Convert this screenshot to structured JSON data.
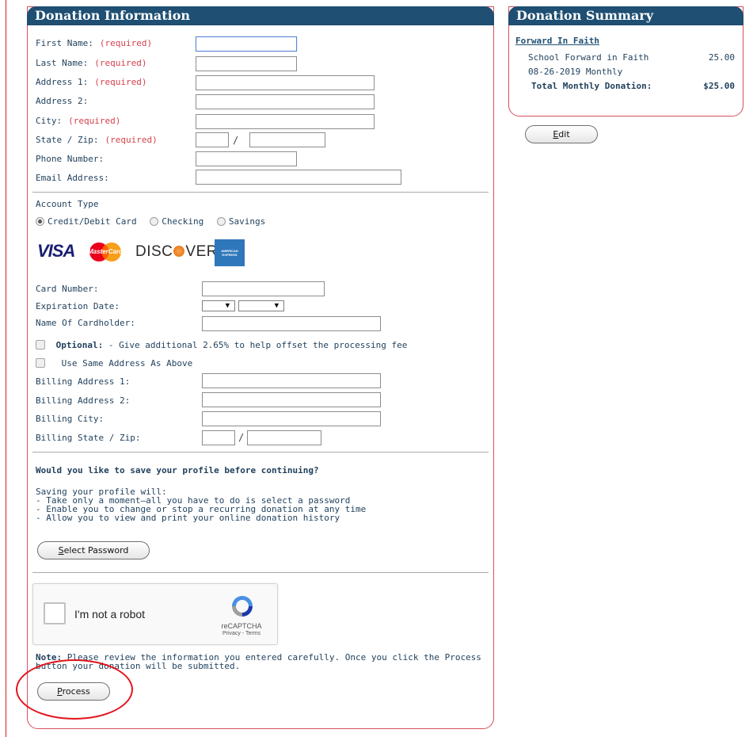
{
  "donation_panel": {
    "title": "Donation Information",
    "required_tag": "(required)",
    "fields": {
      "first_name": "First Name:",
      "last_name": "Last Name:",
      "address1": "Address 1:",
      "address2": "Address 2:",
      "city": "City:",
      "state_zip": "State / Zip:",
      "phone": "Phone Number:",
      "email": "Email Address:"
    },
    "slash": "/",
    "account_type_label": "Account Type",
    "account_types": [
      "Credit/Debit Card",
      "Checking",
      "Savings"
    ],
    "selected_account_type": "Credit/Debit Card",
    "card_logos": {
      "visa": "VISA",
      "mastercard": "MasterCard",
      "discover_a": "DISC",
      "discover_b": "VER",
      "amex": "AMERICAN EXPRESS"
    },
    "card_fields": {
      "card_number": "Card Number:",
      "expiration": "Expiration Date:",
      "cardholder": "Name Of Cardholder:"
    },
    "optional_label": "Optional:",
    "optional_text": " - Give additional 2.65% to help offset the processing fee",
    "same_address": "Use Same Address As Above",
    "billing_fields": {
      "address1": "Billing Address 1:",
      "address2": "Billing Address 2:",
      "city": "Billing City:",
      "state_zip": "Billing State / Zip:"
    },
    "save_profile_title": "Would you like to save your profile before continuing?",
    "save_profile_lines": [
      "Saving your profile will:",
      "- Take only a moment—all you have to do is select a password",
      "- Enable you to change or stop a recurring donation at any time",
      "- Allow you to view and print your online donation history"
    ],
    "select_password_button": {
      "accel": "S",
      "rest": "elect Password"
    },
    "captcha": {
      "label": "I'm not a robot",
      "brand": "reCAPTCHA",
      "links": "Privacy - Terms"
    },
    "note_label": "Note:",
    "note_text": " Please review the information you entered carefully. Once you click the Process button your donation will be submitted.",
    "process_button": {
      "accel": "P",
      "rest": "rocess"
    }
  },
  "summary_panel": {
    "title": "Donation Summary",
    "fund_link": "Forward In Faith",
    "item_label": "School Forward in Faith",
    "item_amount": "25.00",
    "schedule": "08-26-2019 Monthly",
    "total_label": "Total Monthly Donation:",
    "total_amount": "$25.00",
    "edit_button": {
      "accel": "E",
      "rest": "dit"
    }
  },
  "colors": {
    "header_bg": "#1f4f73",
    "panel_border": "#d7505e",
    "required": "#d6424c",
    "annotation_circle": "#e3131b"
  }
}
